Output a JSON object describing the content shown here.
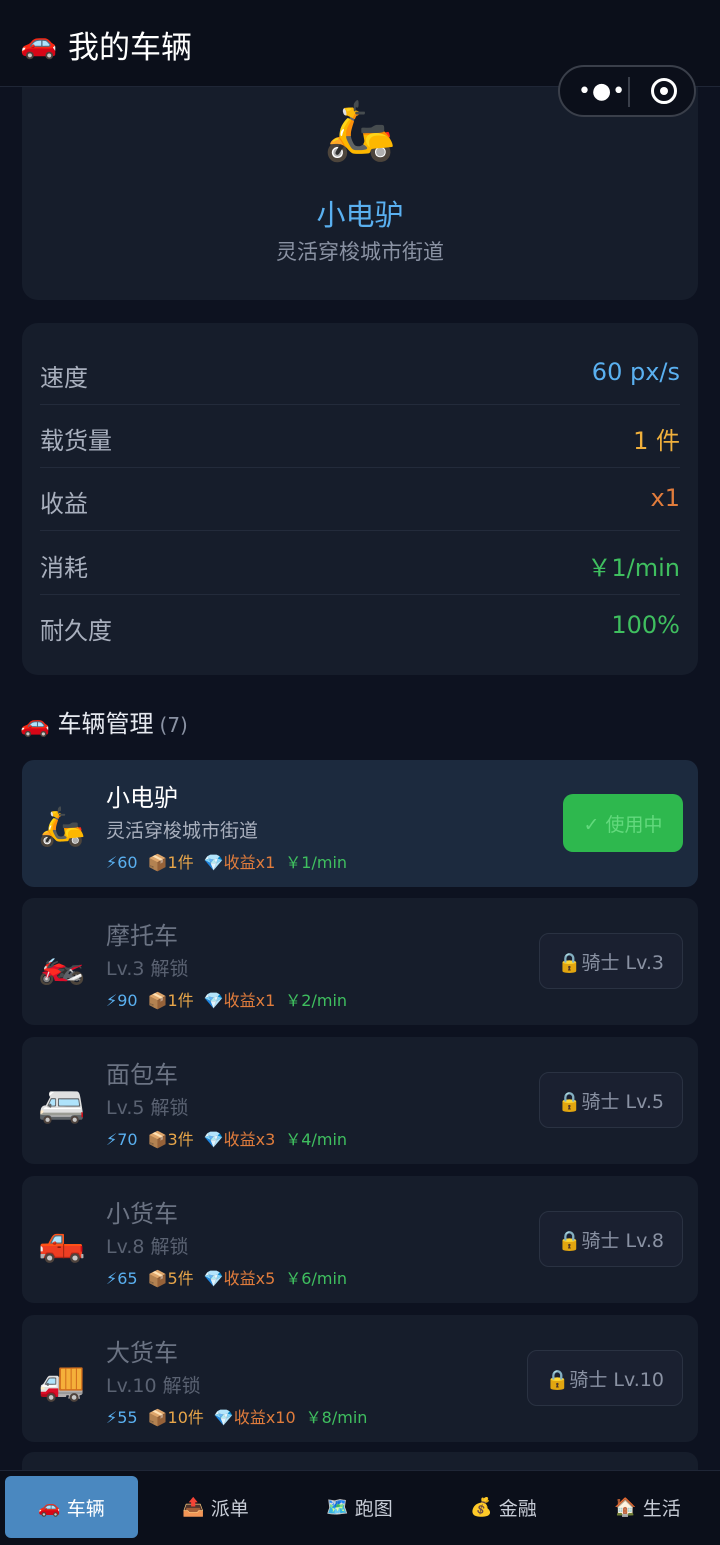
{
  "header": {
    "icon": "car-icon",
    "car_emoji": "🚗",
    "title": "我的车辆"
  },
  "current": {
    "emoji": "🛵",
    "name": "小电驴",
    "desc": "灵活穿梭城市街道"
  },
  "stats": [
    {
      "label": "速度",
      "value": "60 px/s",
      "color": "#5ab0f0"
    },
    {
      "label": "载货量",
      "value": "1 件",
      "color": "#f0b03c"
    },
    {
      "label": "收益",
      "value": "x1",
      "color": "#e07c3c"
    },
    {
      "label": "消耗",
      "value": "￥1/min",
      "color": "#3fbf5f"
    },
    {
      "label": "耐久度",
      "value": "100%",
      "color": "#3fbf5f"
    }
  ],
  "section": {
    "emoji": "🚗",
    "title": "车辆管理",
    "count": "(7)"
  },
  "vehicles": [
    {
      "emoji": "🛵",
      "name": "小电驴",
      "sub": "灵活穿梭城市街道",
      "speed": "⚡60",
      "cap": "📦1件",
      "mult": "💎收益x1",
      "cost": "￥1/min",
      "button": "✓ 使用中",
      "status": "active"
    },
    {
      "emoji": "🏍️",
      "name": "摩托车",
      "sub": "Lv.3 解锁",
      "speed": "⚡90",
      "cap": "📦1件",
      "mult": "💎收益x1",
      "cost": "￥2/min",
      "button": "🔒骑士 Lv.3",
      "status": "locked"
    },
    {
      "emoji": "🚐",
      "name": "面包车",
      "sub": "Lv.5 解锁",
      "speed": "⚡70",
      "cap": "📦3件",
      "mult": "💎收益x3",
      "cost": "￥4/min",
      "button": "🔒骑士 Lv.5",
      "status": "locked"
    },
    {
      "emoji": "🛻",
      "name": "小货车",
      "sub": "Lv.8 解锁",
      "speed": "⚡65",
      "cap": "📦5件",
      "mult": "💎收益x5",
      "cost": "￥6/min",
      "button": "🔒骑士 Lv.8",
      "status": "locked"
    },
    {
      "emoji": "🚚",
      "name": "大货车",
      "sub": "Lv.10 解锁",
      "speed": "⚡55",
      "cap": "📦10件",
      "mult": "💎收益x10",
      "cost": "￥8/min",
      "button": "🔒骑士 Lv.10",
      "status": "locked"
    }
  ],
  "tabs": [
    {
      "icon": "🚗",
      "label": "车辆",
      "active": true
    },
    {
      "icon": "📤",
      "label": "派单",
      "active": false
    },
    {
      "icon": "🗺️",
      "label": "跑图",
      "active": false
    },
    {
      "icon": "💰",
      "label": "金融",
      "active": false
    },
    {
      "icon": "🏠",
      "label": "生活",
      "active": false
    }
  ]
}
